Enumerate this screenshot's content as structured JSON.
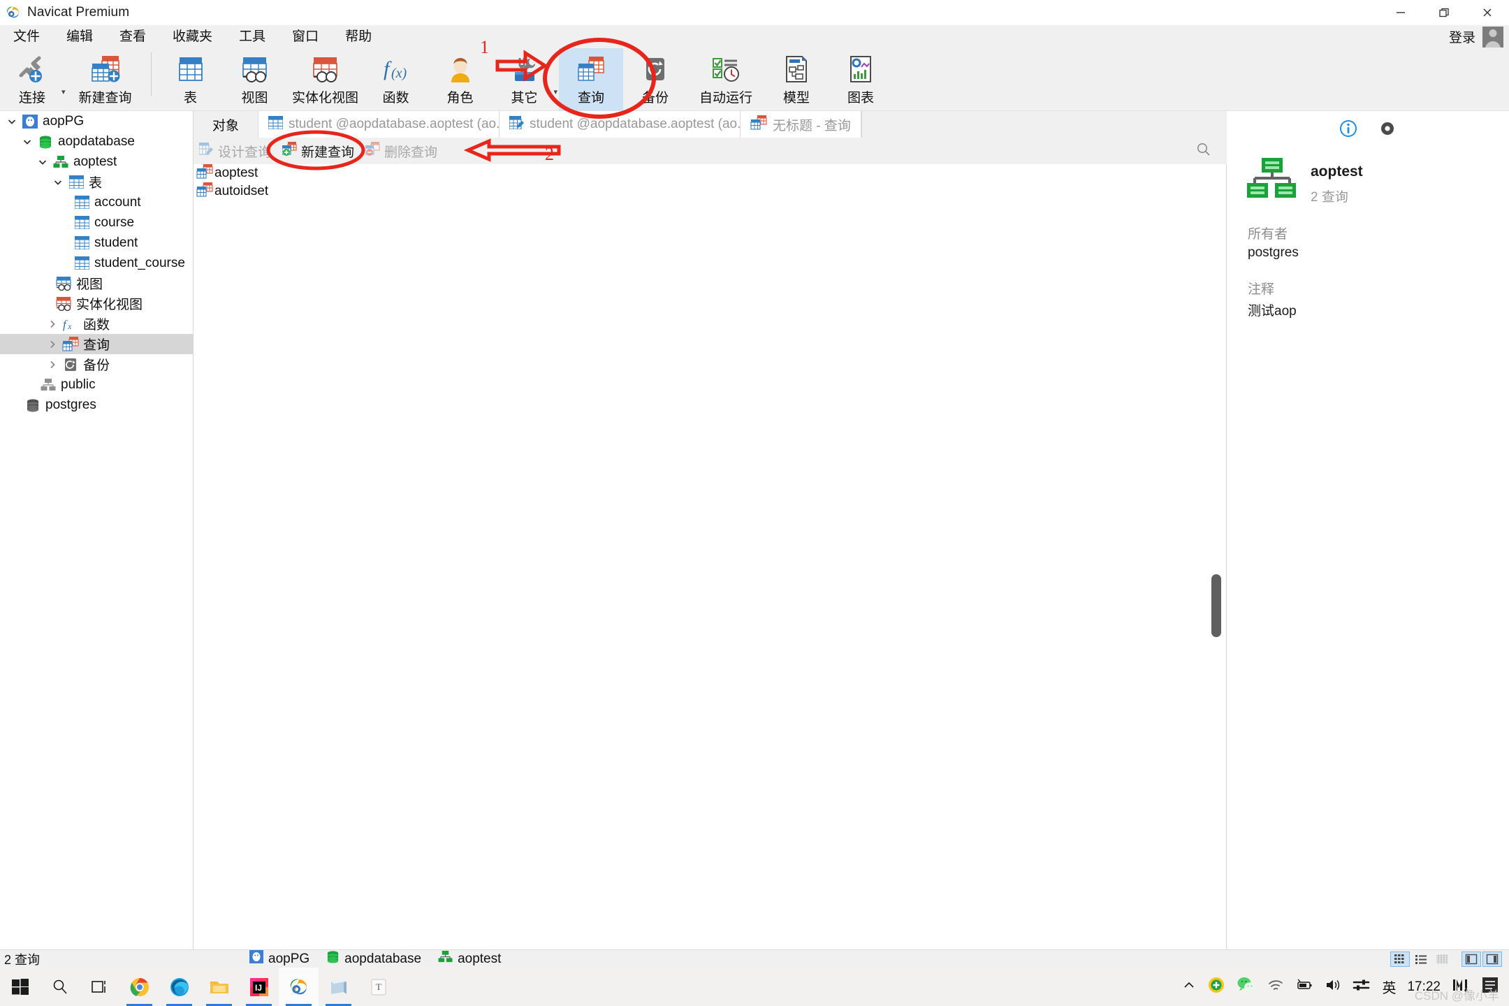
{
  "window": {
    "title": "Navicat Premium",
    "logo_icon": "navicat-logo-icon",
    "minimize_icon": "minimize-icon",
    "restore_icon": "restore-icon",
    "close_icon": "close-icon"
  },
  "menubar": {
    "items": [
      {
        "label": "文件",
        "name": "menu-file"
      },
      {
        "label": "编辑",
        "name": "menu-edit"
      },
      {
        "label": "查看",
        "name": "menu-view"
      },
      {
        "label": "收藏夹",
        "name": "menu-favorites"
      },
      {
        "label": "工具",
        "name": "menu-tools"
      },
      {
        "label": "窗口",
        "name": "menu-window"
      },
      {
        "label": "帮助",
        "name": "menu-help"
      }
    ],
    "login_label": "登录",
    "avatar_icon": "user-avatar-icon"
  },
  "toolbar": {
    "items": [
      {
        "label": "连接",
        "icon": "connection-icon",
        "selected": false,
        "dropdown": true
      },
      {
        "label": "新建查询",
        "icon": "new-query-icon",
        "selected": false,
        "dropdown": false
      },
      {
        "label": "表",
        "icon": "table-icon",
        "selected": false,
        "dropdown": false
      },
      {
        "label": "视图",
        "icon": "view-icon",
        "selected": false,
        "dropdown": false
      },
      {
        "label": "实体化视图",
        "icon": "materialized-view-icon",
        "selected": false,
        "dropdown": false
      },
      {
        "label": "函数",
        "icon": "function-icon",
        "selected": false,
        "dropdown": false
      },
      {
        "label": "角色",
        "icon": "role-icon",
        "selected": false,
        "dropdown": false
      },
      {
        "label": "其它",
        "icon": "other-toolbox-icon",
        "selected": false,
        "dropdown": true
      },
      {
        "label": "查询",
        "icon": "query-icon",
        "selected": true,
        "dropdown": false
      },
      {
        "label": "备份",
        "icon": "backup-icon",
        "selected": false,
        "dropdown": false
      },
      {
        "label": "自动运行",
        "icon": "automation-icon",
        "selected": false,
        "dropdown": false
      },
      {
        "label": "模型",
        "icon": "model-icon",
        "selected": false,
        "dropdown": false
      },
      {
        "label": "图表",
        "icon": "chart-icon",
        "selected": false,
        "dropdown": false
      }
    ]
  },
  "sidebar": {
    "nodes": [
      {
        "label": "aopPG",
        "icon": "postgres-server-icon",
        "indent": 0,
        "twisty": "open",
        "selected": false
      },
      {
        "label": "aopdatabase",
        "icon": "database-icon",
        "indent": 1,
        "twisty": "open",
        "selected": false
      },
      {
        "label": "aoptest",
        "icon": "schema-icon",
        "indent": 2,
        "twisty": "open",
        "selected": false
      },
      {
        "label": "表",
        "icon": "table-icon",
        "indent": 3,
        "twisty": "open",
        "selected": false
      },
      {
        "label": "account",
        "icon": "table-icon",
        "indent": 4,
        "twisty": "none",
        "selected": false
      },
      {
        "label": "course",
        "icon": "table-icon",
        "indent": 4,
        "twisty": "none",
        "selected": false
      },
      {
        "label": "student",
        "icon": "table-icon",
        "indent": 4,
        "twisty": "none",
        "selected": false
      },
      {
        "label": "student_course",
        "icon": "table-icon",
        "indent": 4,
        "twisty": "none",
        "selected": false
      },
      {
        "label": "视图",
        "icon": "view-icon",
        "indent": 3,
        "twisty": "none",
        "selected": false
      },
      {
        "label": "实体化视图",
        "icon": "materialized-view-icon",
        "indent": 3,
        "twisty": "none",
        "selected": false
      },
      {
        "label": "函数",
        "icon": "function-icon",
        "indent": 3,
        "twisty": "closed",
        "selected": false
      },
      {
        "label": "查询",
        "icon": "query-icon",
        "indent": 3,
        "twisty": "closed",
        "selected": true
      },
      {
        "label": "备份",
        "icon": "backup-icon",
        "indent": 3,
        "twisty": "closed",
        "selected": false
      },
      {
        "label": "public",
        "icon": "schema-icon",
        "indent": 2,
        "twisty": "none",
        "selected": false
      },
      {
        "label": "postgres",
        "icon": "database-icon",
        "indent": 1,
        "twisty": "none",
        "selected": false
      }
    ]
  },
  "tabstrip": {
    "objects_label": "对象",
    "tabs": [
      {
        "label": "student @aopdatabase.aoptest (ao...",
        "icon": "table-tab-icon"
      },
      {
        "label": "student @aopdatabase.aoptest (ao...",
        "icon": "table-design-tab-icon"
      },
      {
        "label": "无标题 - 查询",
        "icon": "query-tab-icon"
      }
    ]
  },
  "objbar": {
    "buttons": [
      {
        "label": "设计查询",
        "icon": "design-query-icon",
        "enabled": false
      },
      {
        "label": "新建查询",
        "icon": "new-query-plus-icon",
        "enabled": true
      },
      {
        "label": "删除查询",
        "icon": "delete-query-minus-icon",
        "enabled": false
      }
    ],
    "search_icon": "search-icon"
  },
  "mainlist": {
    "rows": [
      {
        "label": "aoptest",
        "icon": "query-icon"
      },
      {
        "label": "autoidset",
        "icon": "query-icon"
      }
    ]
  },
  "infopane": {
    "info_icon": "info-circle-icon",
    "eye_icon": "preview-eye-icon",
    "object_icon": "schema-large-icon",
    "title": "aoptest",
    "subtitle": "2 查询",
    "fields": [
      {
        "label": "所有者",
        "value": "postgres"
      },
      {
        "label": "注释",
        "value": "测试aop"
      }
    ]
  },
  "statusbar": {
    "left_text": "2 查询",
    "breadcrumbs": [
      {
        "label": "aopPG",
        "icon": "postgres-server-icon"
      },
      {
        "label": "aopdatabase",
        "icon": "database-icon"
      },
      {
        "label": "aoptest",
        "icon": "schema-icon"
      }
    ],
    "view_buttons": [
      {
        "name": "grid-view-button",
        "icon": "grid-view-icon",
        "active": true
      },
      {
        "name": "list-view-button",
        "icon": "list-view-icon",
        "active": false
      },
      {
        "name": "detail-view-button",
        "icon": "detail-view-icon",
        "active": false
      },
      {
        "name": "left-pane-toggle",
        "icon": "left-pane-icon",
        "active": true
      },
      {
        "name": "right-pane-toggle",
        "icon": "right-pane-icon",
        "active": true
      }
    ]
  },
  "taskbar": {
    "start_icon": "windows-start-icon",
    "search_icon": "taskbar-search-icon",
    "taskview_icon": "task-view-icon",
    "apps": [
      {
        "name": "chrome",
        "icon": "chrome-icon",
        "running": true,
        "active": false
      },
      {
        "name": "edge",
        "icon": "edge-icon",
        "running": true,
        "active": false
      },
      {
        "name": "explorer",
        "icon": "file-explorer-icon",
        "running": true,
        "active": false
      },
      {
        "name": "intellij",
        "icon": "intellij-idea-icon",
        "running": true,
        "active": false
      },
      {
        "name": "navicat",
        "icon": "navicat-logo-icon",
        "running": true,
        "active": true
      },
      {
        "name": "book",
        "icon": "book-icon",
        "running": true,
        "active": false
      },
      {
        "name": "typora",
        "icon": "typora-icon",
        "running": false,
        "active": false
      }
    ],
    "tray": {
      "chevron_icon": "chevron-up-icon",
      "icons": [
        {
          "name": "security-shield-icon"
        },
        {
          "name": "wechat-icon"
        },
        {
          "name": "wifi-icon"
        },
        {
          "name": "battery-icon"
        },
        {
          "name": "volume-icon"
        },
        {
          "name": "action-center-icon"
        }
      ],
      "ime_label": "英",
      "clock": "17:22",
      "music_icon": "music-player-icon",
      "note_icon": "note-icon"
    },
    "watermark": "CSDN @像小羊"
  },
  "annotations": {
    "accent_color": "#e8251b",
    "marks": [
      {
        "label": "1",
        "kind": "arrow-right-with-ellipse",
        "target": "toolbar-query-button"
      },
      {
        "label": "2",
        "kind": "arrow-left-with-ellipse",
        "target": "new-query-button"
      }
    ]
  }
}
